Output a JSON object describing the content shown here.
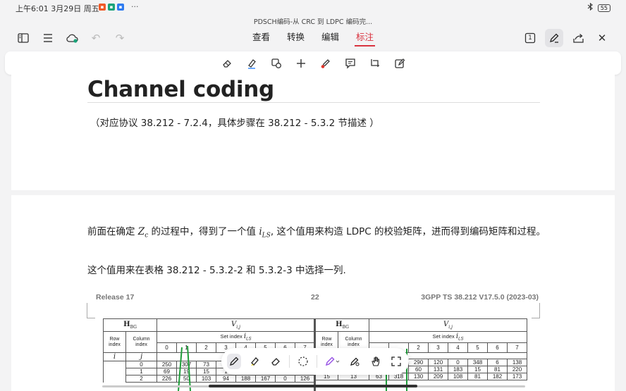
{
  "status_bar": {
    "time": "上午6:01 3月29日 周五",
    "more": "···",
    "battery": "55",
    "notif_colors": [
      "#f05a28",
      "#1aa37a",
      "#2f7bf0"
    ]
  },
  "document": {
    "title": "PDSCH编码-从 CRC 到 LDPC 编码完..."
  },
  "toolbar": {
    "tabs": [
      {
        "label": "查看"
      },
      {
        "label": "转换"
      },
      {
        "label": "编辑"
      },
      {
        "label": "标注",
        "active": true
      }
    ],
    "page_badge": "1",
    "accent": "#d9333f"
  },
  "annotation_tools": [
    "eraser-icon",
    "highlighter-icon",
    "shape-select-icon",
    "add-icon",
    "pen-red-icon",
    "comment-icon",
    "crop-icon",
    "edit-note-icon"
  ],
  "page1": {
    "heading": "Channel coding",
    "subtitle": "（对应协议 38.212 - 7.2.4，具体步骤在 38.212 - 5.3.2 节描述 ）"
  },
  "page2": {
    "para1_a": "前面在确定 ",
    "para1_math1": "Z",
    "para1_sub1": "c",
    "para1_b": " 的过程中，得到了一个值 ",
    "para1_math2": "i",
    "para1_sub2": "LS",
    "para1_c": ", 这个值用来构造 LDPC 的校验矩阵，进而得到编码矩阵和过程。",
    "para2": "这个值用来在表格 38.212 - 5.3.2-2 和 5.3.2-3 中选择一列.",
    "spec_header": {
      "release": "Release 17",
      "page": "22",
      "spec": "3GPP TS 38.212 V17.5.0 (2023-03)"
    },
    "table_left": {
      "h_bg": "H",
      "h_bg_sub": "BG",
      "v_ij": "V",
      "v_sub": "i,j",
      "row_index": "Row index",
      "col_index": "Column index",
      "set_index": "Set index",
      "i_ls": "i",
      "i_ls_sub": "LS",
      "i": "i",
      "j": "j",
      "set_cols": [
        "0",
        "1",
        "2",
        "3",
        "4",
        "5",
        "6",
        "7"
      ],
      "rows": [
        [
          "0",
          "250",
          "307",
          "73",
          "",
          "",
          "",
          "",
          ""
        ],
        [
          "1",
          "69",
          "19",
          "15",
          "1",
          "",
          "",
          "",
          ""
        ],
        [
          "2",
          "226",
          "50",
          "103",
          "94",
          "188",
          "167",
          "0",
          "126"
        ]
      ]
    },
    "table_right": {
      "h_bg": "H",
      "h_bg_sub": "BG",
      "v_ij": "V",
      "v_sub": "i,j",
      "row_index": "Row index",
      "col_index": "Column index",
      "set_index": "Set index",
      "i_ls": "i",
      "i_ls_sub": "LS",
      "set_cols": [
        "2",
        "3",
        "4",
        "5",
        "6",
        "7"
      ],
      "rows": [
        [
          "290",
          "120",
          "0",
          "348",
          "6",
          "138"
        ],
        [
          "60",
          "131",
          "183",
          "15",
          "81",
          "220"
        ],
        [
          "130",
          "209",
          "108",
          "81",
          "182",
          "173"
        ]
      ],
      "row_label": "15",
      "col_label": "13",
      "partial_vals": [
        "63",
        "318"
      ]
    }
  },
  "pen_tools": [
    "pen-icon",
    "highlighter-icon",
    "eraser-icon",
    "lasso-icon",
    "pen-color-icon",
    "shape-pen-icon",
    "hand-icon",
    "fullscreen-icon"
  ],
  "colors": {
    "pen_purple": "#9b59e6",
    "highlight_yellow": "#f5d000",
    "annot_green": "#1f9d3a"
  }
}
